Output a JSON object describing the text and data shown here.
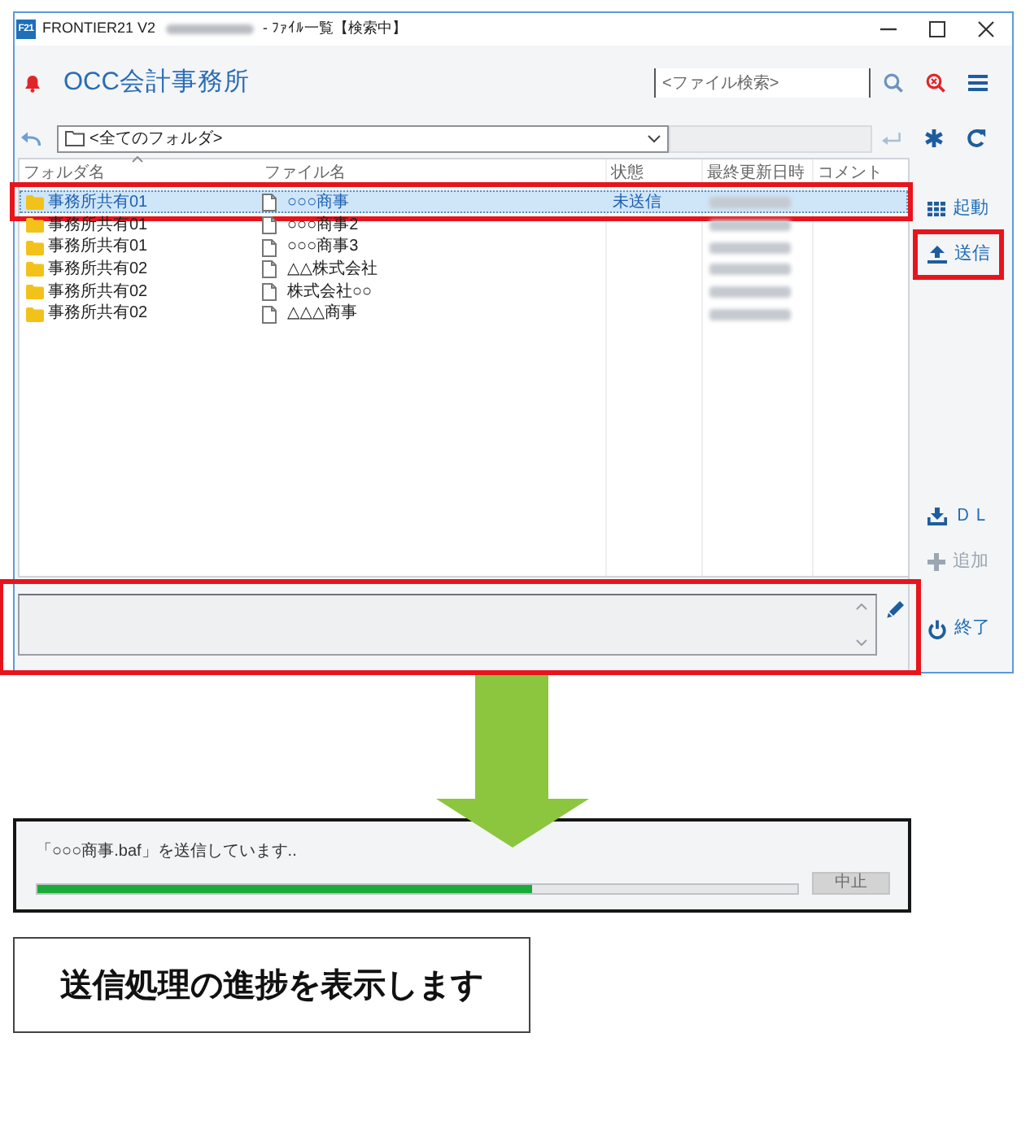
{
  "window": {
    "app_icon": "F21",
    "title": "FRONTIER21 V2",
    "subtitle": "- ﾌｧｲﾙ一覧【検索中】"
  },
  "header": {
    "office_name": "OCC会計事務所",
    "search": {
      "placeholder": "<ファイル検索>"
    }
  },
  "toolbar": {
    "folder_select": {
      "value": "<全てのフォルダ>"
    },
    "path_field": {
      "disabled": true
    }
  },
  "table": {
    "columns": [
      {
        "label": "フォルダ名",
        "sorted": true
      },
      {
        "label": "ファイル名",
        "sorted": false
      },
      {
        "label": "状態",
        "sorted": false
      },
      {
        "label": "最終更新日時",
        "sorted": false
      },
      {
        "label": "コメント",
        "sorted": false
      }
    ],
    "rows": [
      {
        "folder": "事務所共有01",
        "file": "○○○商事",
        "status": "未送信",
        "selected": true,
        "highlighted": true
      },
      {
        "folder": "事務所共有01",
        "file": "○○○商事2",
        "selected": false,
        "highlighted": false
      },
      {
        "folder": "事務所共有01",
        "file": "○○○商事3",
        "selected": false,
        "highlighted": false
      },
      {
        "folder": "事務所共有02",
        "file": "△△株式会社",
        "selected": false,
        "highlighted": false
      },
      {
        "folder": "事務所共有02",
        "file": "株式会社○○",
        "selected": false,
        "highlighted": false
      },
      {
        "folder": "事務所共有02",
        "file": "△△△商事",
        "selected": false,
        "highlighted": false
      }
    ]
  },
  "sidebar": {
    "top_buttons": [
      {
        "kind": "launch",
        "label": "起動",
        "disabled": false,
        "highlighted": false
      },
      {
        "kind": "upload",
        "label": "送信",
        "disabled": false,
        "highlighted": true
      }
    ],
    "lower_buttons": [
      {
        "kind": "download",
        "label": "ＤＬ",
        "disabled": false,
        "highlighted": false
      },
      {
        "kind": "add",
        "label": "追加",
        "disabled": true,
        "highlighted": false
      }
    ],
    "exit_button": {
      "kind": "power",
      "label": "終了",
      "disabled": false,
      "highlighted": false
    }
  },
  "comment": {
    "highlighted": true
  },
  "progress_dialog": {
    "message": "「○○○商事.baf」を送信しています..",
    "level": 0.65,
    "cancel_button": {
      "label": "中止",
      "disabled": true
    }
  },
  "caption": "送信処理の進捗を表示します"
}
